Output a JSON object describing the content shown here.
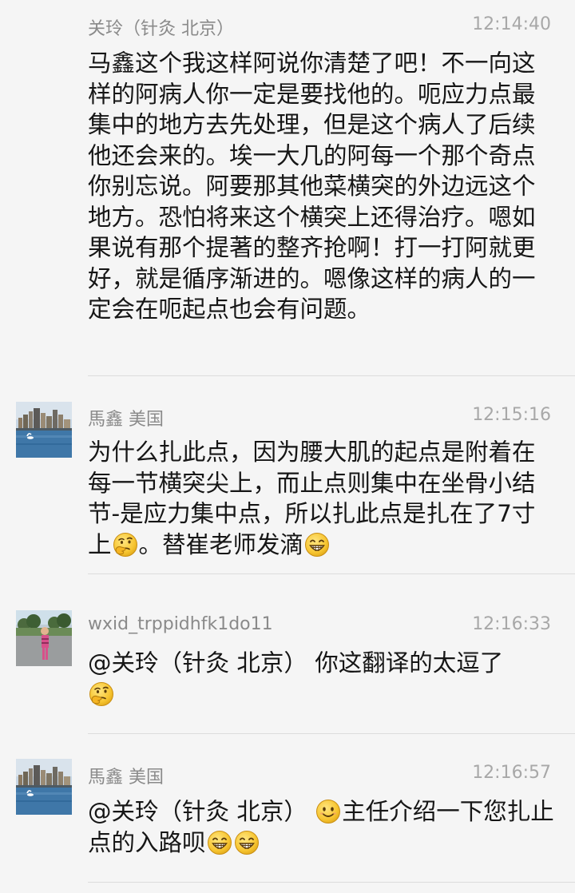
{
  "messages": [
    {
      "sender": "关玲（针灸 北京）",
      "time": "12:14:40",
      "text": "马鑫这个我这样阿说你清楚了吧！不一向这样的阿病人你一定是要找他的。呃应力点最集中的地方去先处理，但是这个病人了后续他还会来的。埃一大几的阿每一个那个奇点你别忘说。阿要那其他菜横突的外边远这个地方。恐怕将来这个横突上还得治疗。嗯如果说有那个提著的整齐抢啊！打一打阿就更好，就是循序渐进的。嗯像这样的病人的一定会在呃起点也会有问题。"
    },
    {
      "sender": "馬鑫 美国",
      "time": "12:15:16",
      "text_a": "为什么扎此点，因为腰大肌的起点是附着在每一节横突尖上，而止点则集中在坐骨小结节-是应力集中点，所以扎此点是扎在了7寸上",
      "emoji_a": "thinking-emoji",
      "text_b": "。替崔老师发滴",
      "emoji_b": "grin-emoji"
    },
    {
      "sender": "wxid_trppidhfk1do11",
      "time": "12:16:33",
      "text": "@关玲（针灸 北京） 你这翻译的太逗了",
      "emoji": "thinking-emoji"
    },
    {
      "sender": "馬鑫 美国",
      "time": "12:16:57",
      "text_a": "@关玲（针灸 北京） ",
      "emoji_a": "smile-emoji",
      "text_b": "主任介绍一下您扎止点的入路呗",
      "emoji_b": "grin-emoji",
      "emoji_c": "grin-emoji"
    }
  ],
  "colors": {
    "background": "#f5f5f5",
    "name": "#8a8a8a",
    "time": "#a8a8a8",
    "text": "#161616",
    "divider": "#dcdcdc"
  }
}
